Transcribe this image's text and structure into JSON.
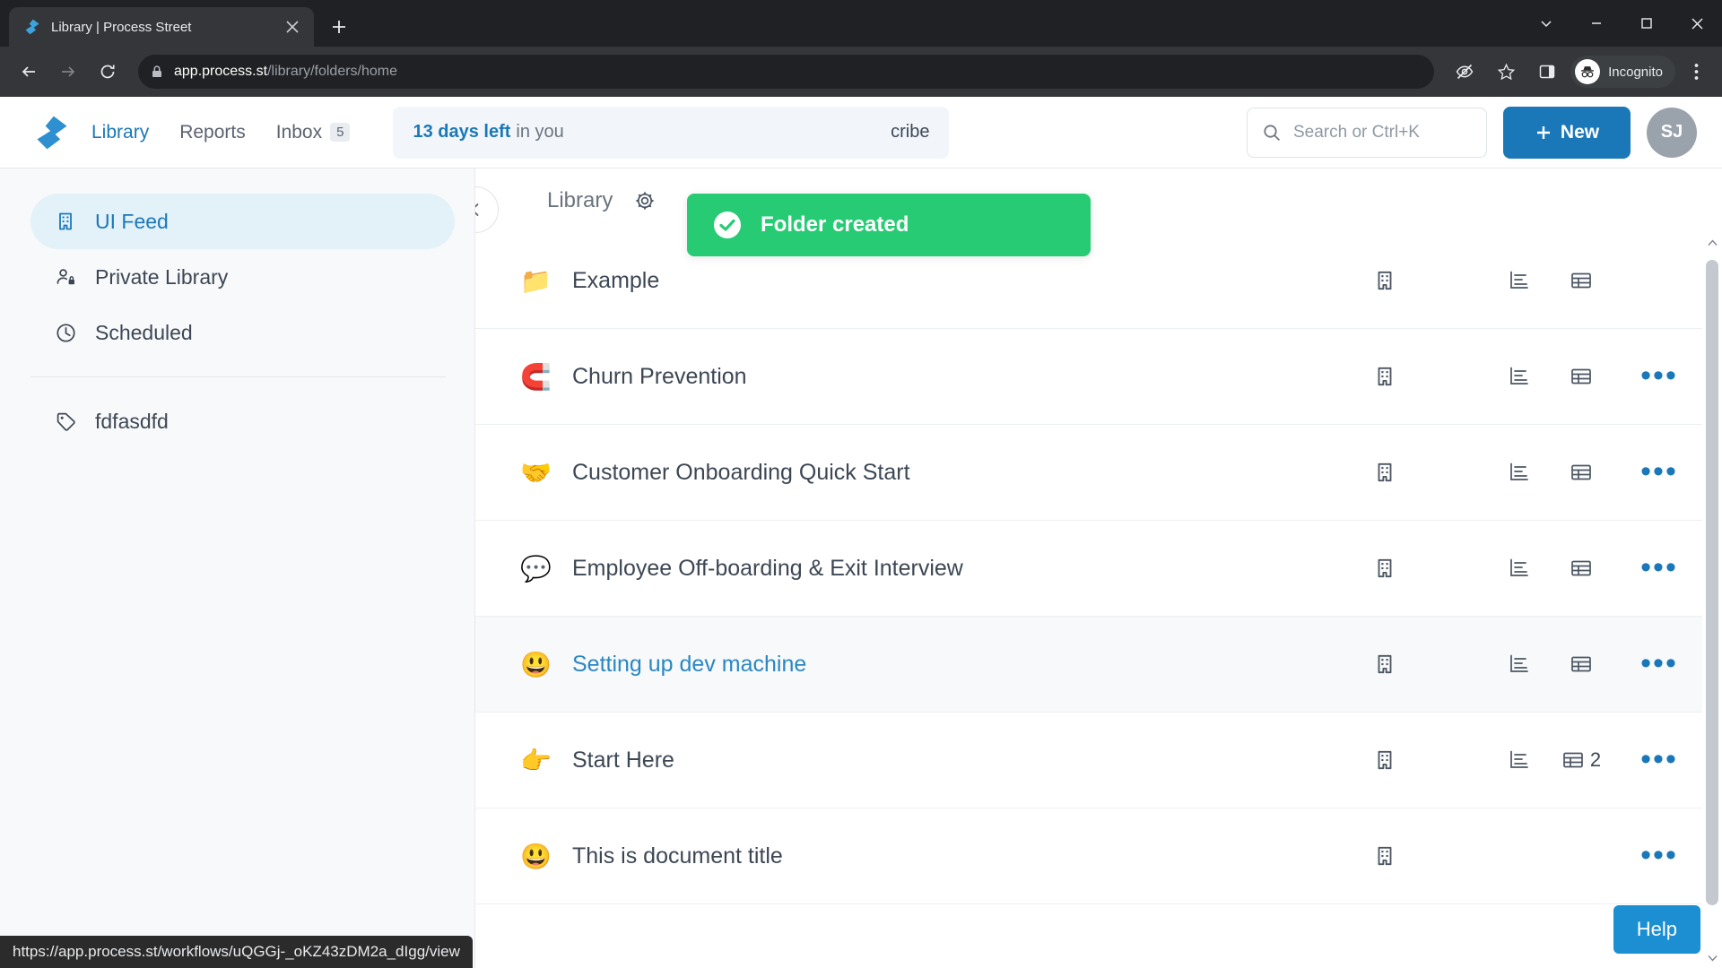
{
  "browser": {
    "tab": {
      "title": "Library | Process Street",
      "favicon_icon": "process-street-logo",
      "close_icon": "close-icon"
    },
    "new_tab_icon": "plus-icon",
    "window_controls": [
      "chevron-down-icon",
      "minimize-icon",
      "maximize-icon",
      "close-icon"
    ],
    "back_icon": "arrow-left-icon",
    "forward_icon": "arrow-right-icon",
    "reload_icon": "reload-icon",
    "lock_icon": "lock-icon",
    "url_strong": "app.process.st",
    "url_dim": "/library/folders/home",
    "right_icons": [
      "eye-off-icon",
      "star-icon",
      "side-panel-icon"
    ],
    "incognito_label": "Incognito",
    "menu_icon": "kebab-menu-icon"
  },
  "appbar": {
    "brand_icon": "process-street-logo",
    "nav": [
      {
        "label": "Library",
        "active": true
      },
      {
        "label": "Reports",
        "active": false
      }
    ],
    "inbox_label": "Inbox",
    "inbox_count": "5",
    "trial_bold": "13 days left",
    "trial_rest": "in you",
    "trial_cta": "cribe",
    "search_placeholder": "Search or Ctrl+K",
    "search_icon": "search-icon",
    "new_button_label": "New",
    "new_button_icon": "plus-icon",
    "avatar_initials": "SJ",
    "accent_color": "#1b78b8"
  },
  "toast": {
    "message": "Folder created",
    "icon": "check-circle-icon",
    "color": "#27cb74"
  },
  "sidebar": {
    "collapse_icon": "chevron-left-icon",
    "items": [
      {
        "label": "UI Feed",
        "icon": "building-icon",
        "active": true
      },
      {
        "label": "Private Library",
        "icon": "user-lock-icon",
        "active": false
      },
      {
        "label": "Scheduled",
        "icon": "clock-icon",
        "active": false
      }
    ],
    "tags": [
      {
        "label": "fdfasdfd",
        "icon": "tag-icon"
      }
    ]
  },
  "main": {
    "breadcrumb": "Library",
    "breadcrumb_gear_icon": "gear-icon",
    "action_icons": {
      "building": "building-icon",
      "chart": "bar-chart-icon",
      "table": "table-icon",
      "more": "more-horizontal-icon"
    },
    "rows": [
      {
        "emoji": "📁",
        "emoji_name": "folder-icon",
        "title": "Example",
        "has_chart": true,
        "has_table": true,
        "table_count": "",
        "has_more": false,
        "hover": false
      },
      {
        "emoji": "🧲",
        "emoji_name": "magnet-emoji",
        "title": "Churn Prevention",
        "has_chart": true,
        "has_table": true,
        "table_count": "",
        "has_more": true,
        "hover": false
      },
      {
        "emoji": "🤝",
        "emoji_name": "handshake-emoji",
        "title": "Customer Onboarding Quick Start",
        "has_chart": true,
        "has_table": true,
        "table_count": "",
        "has_more": true,
        "hover": false
      },
      {
        "emoji": "💬",
        "emoji_name": "speech-balloon-emoji",
        "title": "Employee Off-boarding & Exit Interview",
        "has_chart": true,
        "has_table": true,
        "table_count": "",
        "has_more": true,
        "hover": false
      },
      {
        "emoji": "😃",
        "emoji_name": "grinning-face-emoji",
        "title": "Setting up dev machine",
        "has_chart": true,
        "has_table": true,
        "table_count": "",
        "has_more": true,
        "hover": true
      },
      {
        "emoji": "👉",
        "emoji_name": "pointing-right-emoji",
        "title": "Start Here",
        "has_chart": true,
        "has_table": true,
        "table_count": "2",
        "has_more": true,
        "hover": false
      },
      {
        "emoji": "😃",
        "emoji_name": "grinning-face-emoji",
        "title": "This is document title",
        "has_chart": false,
        "has_table": false,
        "table_count": "",
        "has_more": true,
        "hover": false
      }
    ]
  },
  "status_bar": {
    "url": "https://app.process.st/workflows/uQGGj-_oKZ43zDM2a_dIgg/view"
  },
  "help": {
    "label": "Help",
    "color": "#1b8fd1"
  }
}
